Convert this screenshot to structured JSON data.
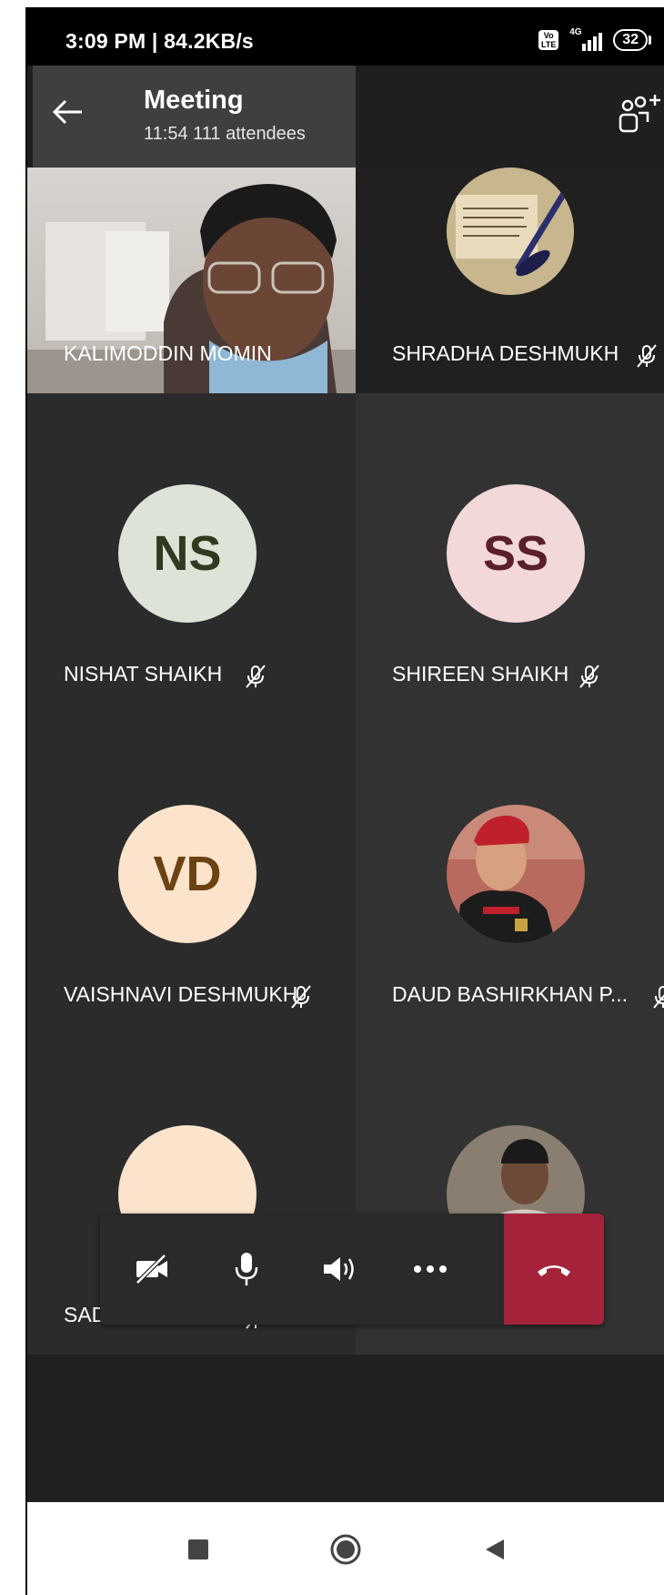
{
  "status_bar": {
    "time_speed": "3:09 PM | 84.2KB/s",
    "volte": "Vo\nLTE",
    "network": "4G",
    "battery": "32"
  },
  "header": {
    "title": "Meeting",
    "subtitle": "11:54  111 attendees"
  },
  "participants": [
    {
      "name": "KALIMODDIN MOMIN",
      "type": "video",
      "muted": false
    },
    {
      "name": "SHRADHA DESHMUKH",
      "type": "photo",
      "muted": true
    },
    {
      "name": "NISHAT SHAIKH",
      "initials": "NS",
      "type": "initials",
      "muted": true,
      "avatar_bg": "#dde3d7",
      "avatar_fg": "#2f3b1f"
    },
    {
      "name": "SHIREEN SHAIKH",
      "initials": "SS",
      "type": "initials",
      "muted": true,
      "avatar_bg": "#f2d8d8",
      "avatar_fg": "#5a1f2a"
    },
    {
      "name": "VAISHNAVI DESHMUKH",
      "initials": "VD",
      "type": "initials",
      "muted": true,
      "avatar_bg": "#fbe3cc",
      "avatar_fg": "#6b4212"
    },
    {
      "name": "DAUD BASHIRKHAN P...",
      "type": "photo",
      "muted": true
    },
    {
      "name": "SADIYA PATHAN",
      "type": "initials",
      "muted": true,
      "avatar_bg": "#fbe3cc"
    },
    {
      "name": "",
      "type": "photo",
      "muted": false
    }
  ],
  "controls": {
    "video_icon": "video-off-icon",
    "mic_icon": "microphone-icon",
    "speaker_icon": "speaker-icon",
    "more_icon": "more-options-icon",
    "hangup_icon": "hang-up-icon",
    "hangup_color": "#a4233b"
  },
  "nav": {
    "recents_icon": "square-icon",
    "home_icon": "circle-icon",
    "back_icon": "triangle-back-icon"
  }
}
